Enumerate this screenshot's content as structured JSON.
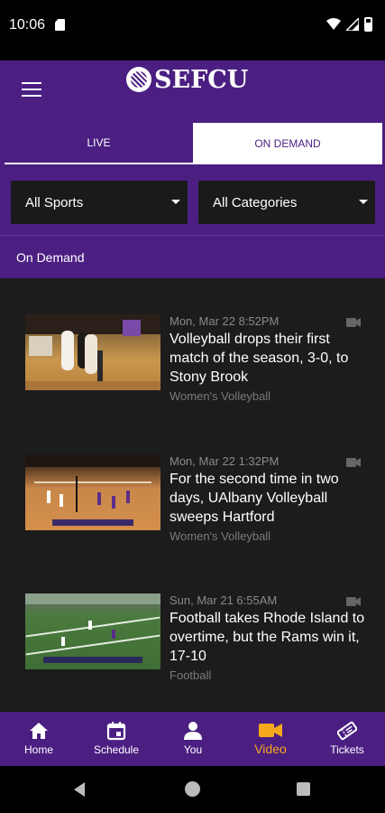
{
  "status_bar": {
    "time": "10:06"
  },
  "header": {
    "logo_text": "SEFCU"
  },
  "tabs": [
    {
      "label": "LIVE",
      "selected": false
    },
    {
      "label": "ON DEMAND",
      "selected": true
    }
  ],
  "filters": {
    "sports": "All Sports",
    "categories": "All Categories"
  },
  "section": {
    "title": "On Demand"
  },
  "videos": [
    {
      "date": "Mon, Mar 22 8:52PM",
      "title": "Volleyball drops their first match of the season, 3-0, to Stony Brook",
      "category": "Women's Volleyball"
    },
    {
      "date": "Mon, Mar 22 1:32PM",
      "title": "For the second time in two days, UAlbany Volleyball sweeps Hartford",
      "category": "Women's Volleyball"
    },
    {
      "date": "Sun, Mar 21 6:55AM",
      "title": "Football takes Rhode Island to overtime, but the Rams win it, 17-10",
      "category": "Football"
    }
  ],
  "bottom_nav": [
    {
      "label": "Home",
      "icon": "home-icon"
    },
    {
      "label": "Schedule",
      "icon": "calendar-icon"
    },
    {
      "label": "You",
      "icon": "person-icon"
    },
    {
      "label": "Video",
      "icon": "video-camera-icon",
      "active": true
    },
    {
      "label": "Tickets",
      "icon": "ticket-icon"
    }
  ],
  "colors": {
    "brand_purple": "#4b1f82",
    "accent_gold": "#f6a81c",
    "list_bg": "#1c1c1c"
  }
}
